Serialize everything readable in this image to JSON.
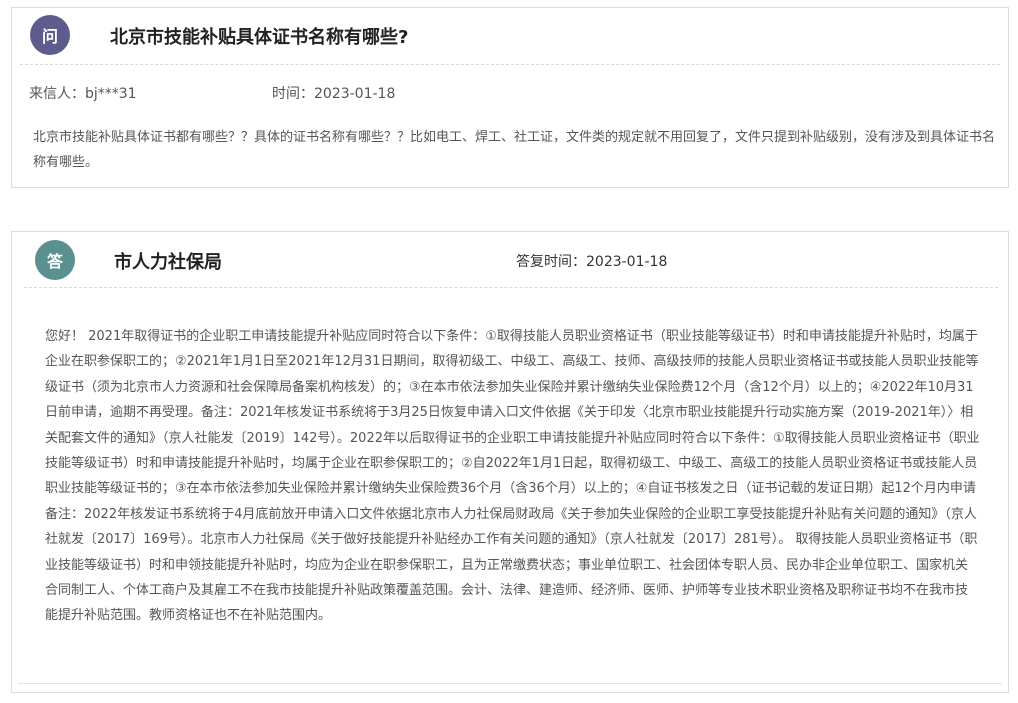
{
  "question": {
    "badge": "问",
    "title": "北京市技能补贴具体证书名称有哪些?",
    "from_label": "来信人：bj***31",
    "time_label": "时间：2023-01-18",
    "content": "北京市技能补贴具体证书都有哪些？？具体的证书名称有哪些？？比如电工、焊工、社工证，文件类的规定就不用回复了，文件只提到补贴级别，没有涉及到具体证书名称有哪些。"
  },
  "answer": {
    "badge": "答",
    "department": "市人力社保局",
    "time_label": "答复时间：2023-01-18",
    "content": "您好！ 2021年取得证书的企业职工申请技能提升补贴应同时符合以下条件：①取得技能人员职业资格证书（职业技能等级证书）时和申请技能提升补贴时，均属于企业在职参保职工的；②2021年1月1日至2021年12月31日期间，取得初级工、中级工、高级工、技师、高级技师的技能人员职业资格证书或技能人员职业技能等级证书（须为北京市人力资源和社会保障局备案机构核发）的；③在本市依法参加失业保险并累计缴纳失业保险费12个月（含12个月）以上的；④2022年10月31日前申请，逾期不再受理。备注：2021年核发证书系统将于3月25日恢复申请入口文件依据《关于印发〈北京市职业技能提升行动实施方案（2019-2021年）〉相关配套文件的通知》（京人社能发〔2019〕142号）。2022年以后取得证书的企业职工申请技能提升补贴应同时符合以下条件：①取得技能人员职业资格证书（职业技能等级证书）时和申请技能提升补贴时，均属于企业在职参保职工的；②自2022年1月1日起，取得初级工、中级工、高级工的技能人员职业资格证书或技能人员职业技能等级证书的；③在本市依法参加失业保险并累计缴纳失业保险费36个月（含36个月）以上的；④自证书核发之日（证书记载的发证日期）起12个月内申请备注：2022年核发证书系统将于4月底前放开申请入口文件依据北京市人力社保局财政局《关于参加失业保险的企业职工享受技能提升补贴有关问题的通知》（京人社就发〔2017〕169号）。北京市人力社保局《关于做好技能提升补贴经办工作有关问题的通知》（京人社就发〔2017〕281号）。 取得技能人员职业资格证书（职业技能等级证书）时和申领技能提升补贴时，均应为企业在职参保职工，且为正常缴费状态；事业单位职工、社会团体专职人员、民办非企业单位职工、国家机关合同制工人、个体工商户及其雇工不在我市技能提升补贴政策覆盖范围。会计、法律、建造师、经济师、医师、护师等专业技术职业资格及职称证书均不在我市技能提升补贴范围。教师资格证也不在补贴范围内。"
  },
  "colors": {
    "question_badge": "#5e5c8c",
    "answer_badge": "#5a9090"
  }
}
